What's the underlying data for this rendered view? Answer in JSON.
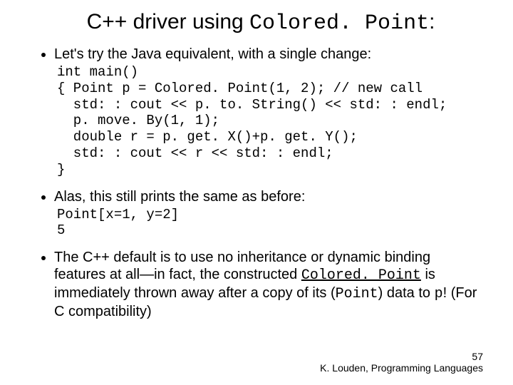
{
  "title": {
    "pre": "C++ driver using ",
    "code": "Colored. Point",
    "post": ":"
  },
  "bullet1": "Let's try the Java equivalent, with a single change:",
  "code_block": "int main()\n{ Point p = Colored. Point(1, 2); // new call\n  std: : cout << p. to. String() << std: : endl;\n  p. move. By(1, 1);\n  double r = p. get. X()+p. get. Y();\n  std: : cout << r << std: : endl;\n}",
  "bullet2": "Alas, this still prints the same as before:",
  "output_block": "Point[x=1, y=2]\n5",
  "bullet3": {
    "a": "The C++ default is to use no inheritance or dynamic binding features at all—in fact, the constructed ",
    "b": "Colored. Point",
    "c": " is immediately thrown away after a copy of its (",
    "d": "Point",
    "e": ") data to ",
    "f": "p",
    "g": "! (For C compatibility)"
  },
  "footer": {
    "page": "57",
    "credit": "K. Louden, Programming Languages"
  }
}
